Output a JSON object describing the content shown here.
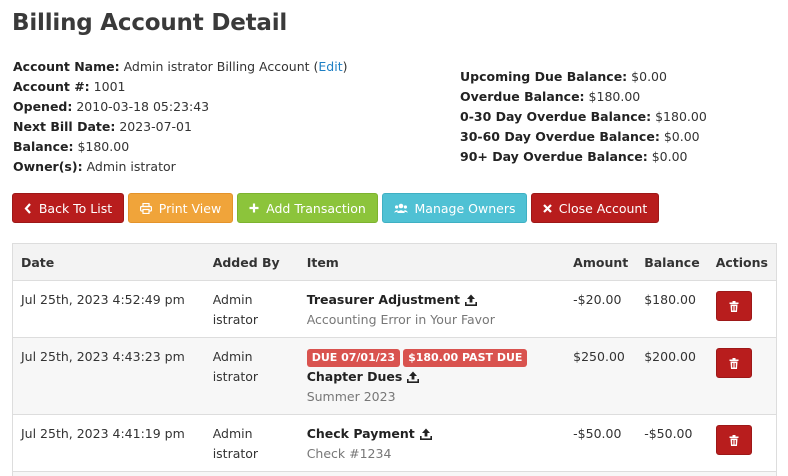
{
  "page_title": "Billing Account Detail",
  "account_info": {
    "name_label": "Account Name:",
    "name_value": "Admin istrator Billing Account",
    "edit_link": "Edit",
    "number_label": "Account #:",
    "number_value": "1001",
    "opened_label": "Opened:",
    "opened_value": "2010-03-18 05:23:43",
    "next_bill_label": "Next Bill Date:",
    "next_bill_value": "2023-07-01",
    "balance_label": "Balance:",
    "balance_value": "$180.00",
    "owners_label": "Owner(s):",
    "owners_value": "Admin istrator"
  },
  "balances": {
    "upcoming_label": "Upcoming Due Balance:",
    "upcoming_value": "$0.00",
    "overdue_label": "Overdue Balance:",
    "overdue_value": "$180.00",
    "d0_30_label": "0-30 Day Overdue Balance:",
    "d0_30_value": "$180.00",
    "d30_60_label": "30-60 Day Overdue Balance:",
    "d30_60_value": "$0.00",
    "d90_label": "90+ Day Overdue Balance:",
    "d90_value": "$0.00"
  },
  "toolbar": {
    "back_label": "Back To List",
    "print_label": "Print View",
    "add_label": "Add Transaction",
    "owners_label": "Manage Owners",
    "close_label": "Close Account"
  },
  "table": {
    "headers": [
      "Date",
      "Added By",
      "Item",
      "Amount",
      "Balance",
      "Actions"
    ],
    "rows": [
      {
        "date": "Jul 25th, 2023 4:52:49 pm",
        "added_by_line1": "Admin",
        "added_by_line2": "istrator",
        "badges": [],
        "item_title": "Treasurer Adjustment",
        "item_sub": "Accounting Error in Your Favor",
        "amount": "-$20.00",
        "balance": "$180.00"
      },
      {
        "date": "Jul 25th, 2023 4:43:23 pm",
        "added_by_line1": "Admin",
        "added_by_line2": "istrator",
        "badges": [
          "DUE 07/01/23",
          "$180.00 PAST DUE"
        ],
        "item_title": "Chapter Dues",
        "item_sub": "Summer 2023",
        "amount": "$250.00",
        "balance": "$200.00"
      },
      {
        "date": "Jul 25th, 2023 4:41:19 pm",
        "added_by_line1": "Admin",
        "added_by_line2": "istrator",
        "badges": [],
        "item_title": "Check Payment",
        "item_sub": "Check #1234",
        "amount": "-$50.00",
        "balance": "-$50.00"
      }
    ]
  },
  "icons": {
    "back": "chevron-left-icon",
    "print": "print-icon",
    "add": "plus-icon",
    "owners": "users-icon",
    "close": "x-icon",
    "upload": "upload-icon",
    "delete": "trash-icon"
  },
  "colors": {
    "danger": "#b81d1d",
    "warning": "#f0a43a",
    "success": "#8cc43b",
    "info": "#4fc1d4",
    "badge": "#d9534f",
    "link": "#1d7fc4"
  }
}
